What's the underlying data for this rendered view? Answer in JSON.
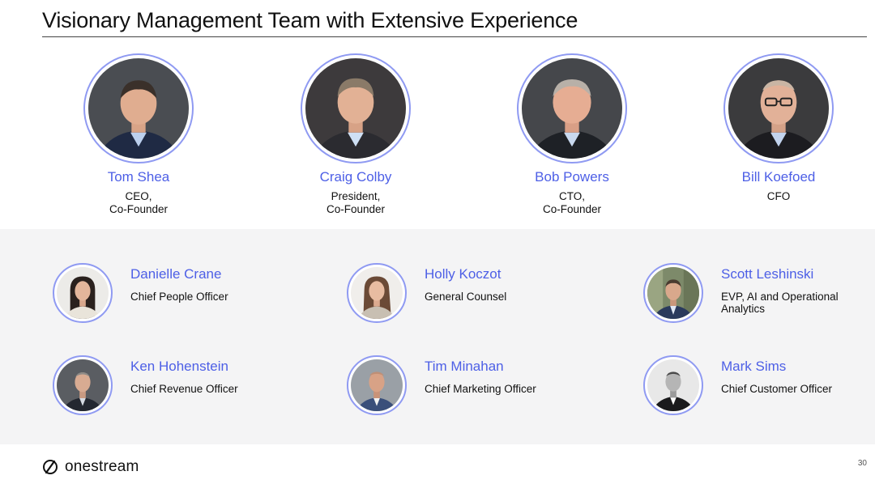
{
  "slide": {
    "title": "Visionary Management Team with Extensive Experience",
    "page_number": "30"
  },
  "leaders": [
    {
      "name": "Tom Shea",
      "role": "CEO,\nCo-Founder"
    },
    {
      "name": "Craig Colby",
      "role": "President,\nCo-Founder"
    },
    {
      "name": "Bob Powers",
      "role": "CTO,\nCo-Founder"
    },
    {
      "name": "Bill Koefoed",
      "role": "CFO"
    }
  ],
  "members": [
    {
      "name": "Danielle Crane",
      "role": "Chief People Officer"
    },
    {
      "name": "Holly Koczot",
      "role": "General Counsel"
    },
    {
      "name": "Scott Leshinski",
      "role": "EVP, AI and Operational\nAnalytics"
    },
    {
      "name": "Ken Hohenstein",
      "role": "Chief Revenue Officer"
    },
    {
      "name": "Tim Minahan",
      "role": "Chief Marketing Officer"
    },
    {
      "name": "Mark Sims",
      "role": "Chief Customer Officer"
    }
  ],
  "footer": {
    "brand": "onestream",
    "logo_icon": "onestream-logo-icon"
  },
  "colors": {
    "name_accent": "#4d5fe6",
    "ring": "#8f9af2"
  }
}
